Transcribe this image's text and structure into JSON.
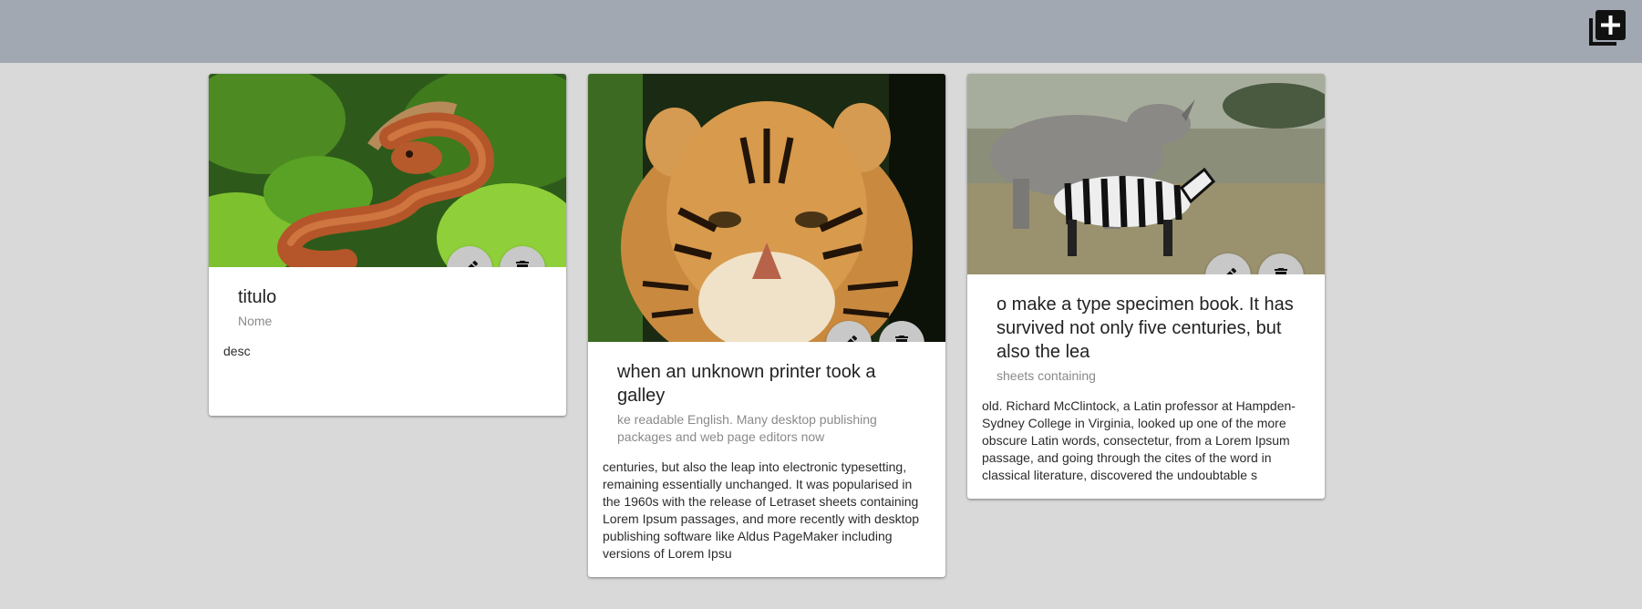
{
  "toolbar": {
    "add_icon": "add-box-icon"
  },
  "actions": {
    "edit_icon": "pencil-icon",
    "delete_icon": "trash-icon"
  },
  "cards": [
    {
      "image": "snake-photo",
      "title": "titulo",
      "subtitle": "Nome",
      "description": "desc"
    },
    {
      "image": "tiger-photo",
      "title": "when an unknown printer took a galley",
      "subtitle": "ke readable English. Many desktop publishing packages and web page editors now",
      "description": "centuries, but also the leap into electronic typesetting, remaining essentially unchanged. It was popularised in the 1960s with the release of Letraset sheets containing Lorem Ipsum passages, and more recently with desktop publishing software like Aldus PageMaker including versions of Lorem Ipsu"
    },
    {
      "image": "rhino-zebra-photo",
      "title": "o make a type specimen book. It has survived not only five centuries, but also the lea",
      "subtitle": "sheets containing",
      "description": "old. Richard McClintock, a Latin professor at Hampden-Sydney College in Virginia, looked up one of the more obscure Latin words, consectetur, from a Lorem Ipsum passage, and going through the cites of the word in classical literature, discovered the undoubtable s"
    }
  ]
}
